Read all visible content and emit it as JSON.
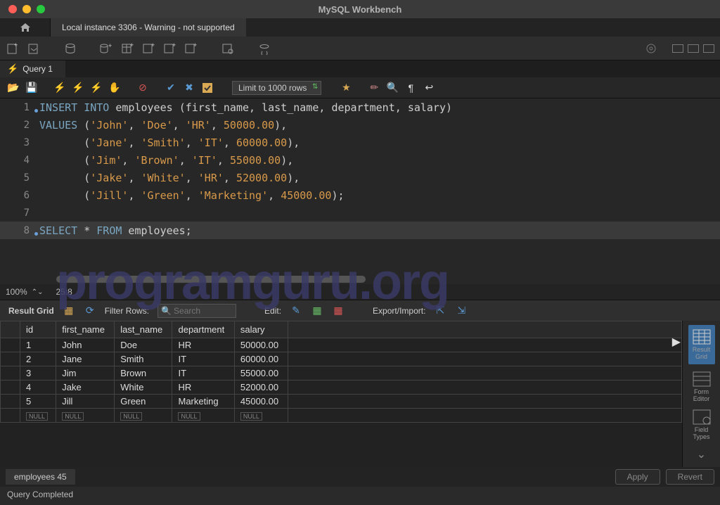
{
  "title": "MySQL Workbench",
  "conn_tab": "Local instance 3306 - Warning - not supported",
  "query_tab": "Query 1",
  "limit_combo": "Limit to 1000 rows",
  "zoom": "100%",
  "cursor": "25:8",
  "result_label": "Result Grid",
  "filter_label": "Filter Rows:",
  "search_ph": "Search",
  "edit_label": "Edit:",
  "export_label": "Export/Import:",
  "side": {
    "result": "Result\nGrid",
    "form": "Form\nEditor",
    "field": "Field\nTypes"
  },
  "bottom_tab": "employees 45",
  "apply": "Apply",
  "revert": "Revert",
  "status": "Query Completed",
  "watermark": "programguru.org",
  "null": "NULL",
  "sql": {
    "l1": {
      "a": "INSERT",
      "b": "INTO",
      "c": " employees ",
      "d": "(",
      "e": "first_name",
      "f": ", ",
      "g": "last_name",
      "h": ", ",
      "i": "department",
      "j": ", ",
      "k": "salary",
      "l": ")"
    },
    "l2": {
      "a": "VALUES",
      "b": " (",
      "c": "'John'",
      "d": ", ",
      "e": "'Doe'",
      "f": ", ",
      "g": "'HR'",
      "h": ", ",
      "i": "50000.00",
      "j": "),"
    },
    "l3": {
      "a": "       (",
      "b": "'Jane'",
      "c": ", ",
      "d": "'Smith'",
      "e": ", ",
      "f": "'IT'",
      "g": ", ",
      "h": "60000.00",
      "i": "),"
    },
    "l4": {
      "a": "       (",
      "b": "'Jim'",
      "c": ", ",
      "d": "'Brown'",
      "e": ", ",
      "f": "'IT'",
      "g": ", ",
      "h": "55000.00",
      "i": "),"
    },
    "l5": {
      "a": "       (",
      "b": "'Jake'",
      "c": ", ",
      "d": "'White'",
      "e": ", ",
      "f": "'HR'",
      "g": ", ",
      "h": "52000.00",
      "i": "),"
    },
    "l6": {
      "a": "       (",
      "b": "'Jill'",
      "c": ", ",
      "d": "'Green'",
      "e": ", ",
      "f": "'Marketing'",
      "g": ", ",
      "h": "45000.00",
      "i": ");"
    },
    "l8": {
      "a": "SELECT",
      "b": " * ",
      "c": "FROM",
      "d": " employees;"
    }
  },
  "cols": [
    "id",
    "first_name",
    "last_name",
    "department",
    "salary"
  ],
  "rows": [
    [
      "1",
      "John",
      "Doe",
      "HR",
      "50000.00"
    ],
    [
      "2",
      "Jane",
      "Smith",
      "IT",
      "60000.00"
    ],
    [
      "3",
      "Jim",
      "Brown",
      "IT",
      "55000.00"
    ],
    [
      "4",
      "Jake",
      "White",
      "HR",
      "52000.00"
    ],
    [
      "5",
      "Jill",
      "Green",
      "Marketing",
      "45000.00"
    ]
  ]
}
